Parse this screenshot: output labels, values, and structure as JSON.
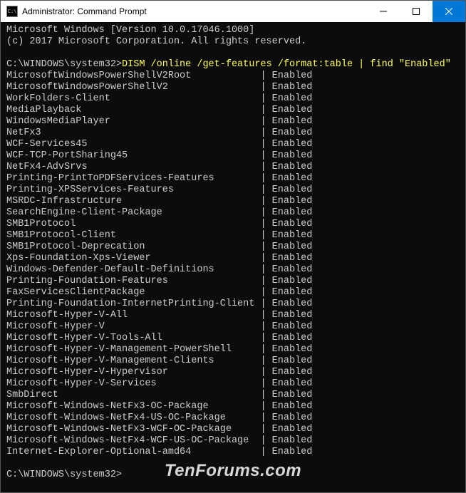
{
  "titlebar": {
    "icon_label": "C:\\",
    "title": "Administrator: Command Prompt"
  },
  "header": {
    "line1": "Microsoft Windows [Version 10.0.17046.1000]",
    "line2": "(c) 2017 Microsoft Corporation. All rights reserved."
  },
  "prompt1": "C:\\WINDOWS\\system32>",
  "command": "DISM /online /get-features /format:table | find \"Enabled\"",
  "features": [
    {
      "name": "MicrosoftWindowsPowerShellV2Root",
      "status": "Enabled"
    },
    {
      "name": "MicrosoftWindowsPowerShellV2",
      "status": "Enabled"
    },
    {
      "name": "WorkFolders-Client",
      "status": "Enabled"
    },
    {
      "name": "MediaPlayback",
      "status": "Enabled"
    },
    {
      "name": "WindowsMediaPlayer",
      "status": "Enabled"
    },
    {
      "name": "NetFx3",
      "status": "Enabled"
    },
    {
      "name": "WCF-Services45",
      "status": "Enabled"
    },
    {
      "name": "WCF-TCP-PortSharing45",
      "status": "Enabled"
    },
    {
      "name": "NetFx4-AdvSrvs",
      "status": "Enabled"
    },
    {
      "name": "Printing-PrintToPDFServices-Features",
      "status": "Enabled"
    },
    {
      "name": "Printing-XPSServices-Features",
      "status": "Enabled"
    },
    {
      "name": "MSRDC-Infrastructure",
      "status": "Enabled"
    },
    {
      "name": "SearchEngine-Client-Package",
      "status": "Enabled"
    },
    {
      "name": "SMB1Protocol",
      "status": "Enabled"
    },
    {
      "name": "SMB1Protocol-Client",
      "status": "Enabled"
    },
    {
      "name": "SMB1Protocol-Deprecation",
      "status": "Enabled"
    },
    {
      "name": "Xps-Foundation-Xps-Viewer",
      "status": "Enabled"
    },
    {
      "name": "Windows-Defender-Default-Definitions",
      "status": "Enabled"
    },
    {
      "name": "Printing-Foundation-Features",
      "status": "Enabled"
    },
    {
      "name": "FaxServicesClientPackage",
      "status": "Enabled"
    },
    {
      "name": "Printing-Foundation-InternetPrinting-Client",
      "status": "Enabled"
    },
    {
      "name": "Microsoft-Hyper-V-All",
      "status": "Enabled"
    },
    {
      "name": "Microsoft-Hyper-V",
      "status": "Enabled"
    },
    {
      "name": "Microsoft-Hyper-V-Tools-All",
      "status": "Enabled"
    },
    {
      "name": "Microsoft-Hyper-V-Management-PowerShell",
      "status": "Enabled"
    },
    {
      "name": "Microsoft-Hyper-V-Management-Clients",
      "status": "Enabled"
    },
    {
      "name": "Microsoft-Hyper-V-Hypervisor",
      "status": "Enabled"
    },
    {
      "name": "Microsoft-Hyper-V-Services",
      "status": "Enabled"
    },
    {
      "name": "SmbDirect",
      "status": "Enabled"
    },
    {
      "name": "Microsoft-Windows-NetFx3-OC-Package",
      "status": "Enabled"
    },
    {
      "name": "Microsoft-Windows-NetFx4-US-OC-Package",
      "status": "Enabled"
    },
    {
      "name": "Microsoft-Windows-NetFx3-WCF-OC-Package",
      "status": "Enabled"
    },
    {
      "name": "Microsoft-Windows-NetFx4-WCF-US-OC-Package",
      "status": "Enabled"
    },
    {
      "name": "Internet-Explorer-Optional-amd64",
      "status": "Enabled"
    }
  ],
  "prompt2": "C:\\WINDOWS\\system32>",
  "watermark": "TenForums.com",
  "feature_col_width": 44
}
